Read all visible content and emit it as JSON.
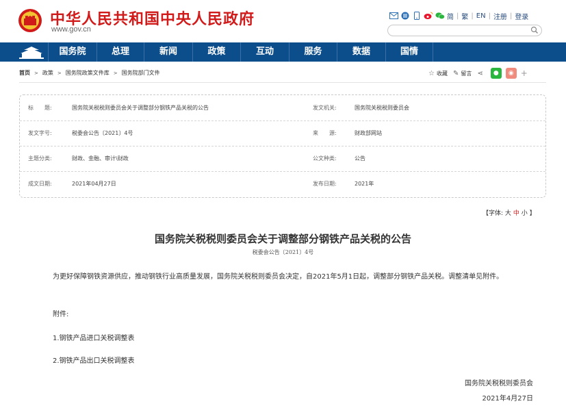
{
  "header": {
    "site_name": "中华人民共和国中央人民政府",
    "site_url": "www.gov.cn",
    "toplinks": [
      "简",
      "繁",
      "EN",
      "注册",
      "登录"
    ],
    "icons": [
      "mail-icon",
      "rss-icon",
      "mobile-icon",
      "weibo-icon",
      "wechat-icon"
    ],
    "search": {
      "placeholder": ""
    }
  },
  "nav": {
    "items": [
      "国务院",
      "总理",
      "新闻",
      "政策",
      "互动",
      "服务",
      "数据",
      "国情"
    ]
  },
  "breadcrumb": {
    "items": [
      "首页",
      "政策",
      "国务院政策文件库",
      "国务院部门文件"
    ]
  },
  "tools": {
    "favorite": "收藏",
    "comment": "留言"
  },
  "meta": {
    "title_label": "标　　题:",
    "title_value": "国务院关税税则委员会关于调整部分钢铁产品关税的公告",
    "issuer_label": "发文机关:",
    "issuer_value": "国务院关税税则委员会",
    "docno_label": "发文字号:",
    "docno_value": "税委会公告〔2021〕4号",
    "source_label": "来　　源:",
    "source_value": "财政部网站",
    "topic_label": "主题分类:",
    "topic_value": "财政、金融、审计\\财政",
    "type_label": "公文种类:",
    "type_value": "公告",
    "date_label": "成文日期:",
    "date_value": "2021年04月27日",
    "pub_label": "发布日期:",
    "pub_value": "2021年"
  },
  "fontsize": {
    "prefix": "【字体:",
    "large": "大",
    "medium": "中",
    "small": "小",
    "suffix": "】"
  },
  "article": {
    "title": "国务院关税税则委员会关于调整部分钢铁产品关税的公告",
    "doc_number": "税委会公告〔2021〕4号",
    "paragraph": "为更好保障钢铁资源供应，推动钢铁行业高质量发展，国务院关税税则委员会决定，自2021年5月1日起，调整部分钢铁产品关税。调整清单见附件。",
    "attachment_label": "附件:",
    "attachment_1": "1.钢铁产品进口关税调整表",
    "attachment_2": "2.钢铁产品出口关税调整表",
    "signature": "国务院关税税则委员会",
    "date": "2021年4月27日"
  },
  "colors": {
    "brand_red": "#d11b1b",
    "nav_blue": "#0c4d8b",
    "wechat_green": "#2bb640",
    "weibo_red": "#e6162d"
  }
}
